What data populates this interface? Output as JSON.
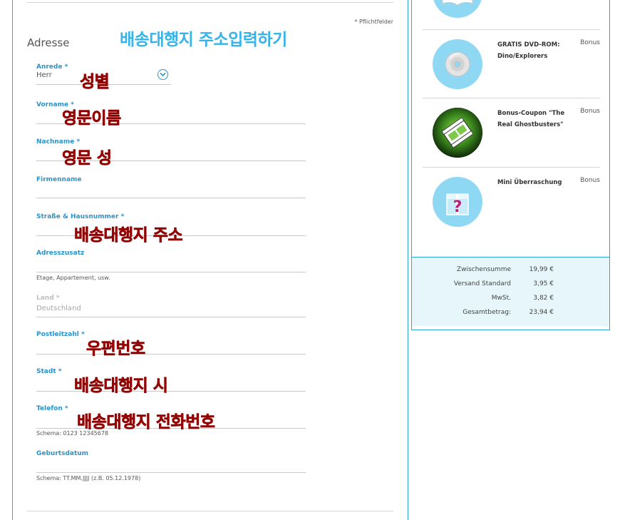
{
  "form": {
    "required_note": "* Pflichtfelder",
    "section_title": "Adresse",
    "fields": {
      "salutation": {
        "label": "Anrede *",
        "value": "Herr"
      },
      "first_name": {
        "label": "Vorname *"
      },
      "last_name": {
        "label": "Nachname *"
      },
      "company": {
        "label": "Firmenname"
      },
      "street": {
        "label": "Straße & Hausnummer *"
      },
      "address_extra": {
        "label": "Adresszusatz",
        "hint": "Etage, Appartement, usw."
      },
      "country": {
        "label": "Land *",
        "value": "Deutschland"
      },
      "zip": {
        "label": "Postleitzahl *"
      },
      "city": {
        "label": "Stadt *"
      },
      "phone": {
        "label": "Telefon *",
        "hint": "Schema: 0123 12345678"
      },
      "birthdate": {
        "label": "Geburtsdatum",
        "hint": "Schema: TT.MM.JJJJ (z.B. 05.12.1978)"
      }
    }
  },
  "annotations": {
    "title": "배송대행지 주소입력하기",
    "salutation": "성별",
    "first_name": "영문이름",
    "last_name": "영문 성",
    "street": "배송대행지 주소",
    "zip": "우편번호",
    "city": "배송대행지 시",
    "phone": "배송대행지 전화번호"
  },
  "cart": {
    "items": [
      {
        "name": "GRATIS DVD-ROM: Dino/Explorers",
        "badge": "Bonus",
        "icon": "dvd-icon"
      },
      {
        "name": "Bonus-Coupon \"The Real Ghostbusters\"",
        "badge": "Bonus",
        "icon": "film-icon"
      },
      {
        "name": "Mini Überraschung",
        "badge": "Bonus",
        "icon": "gift-question-icon"
      }
    ],
    "totals": [
      {
        "label": "Zwischensumme",
        "value": "19,99 €"
      },
      {
        "label": "Versand Standard",
        "value": "3,95 €"
      },
      {
        "label": "MwSt.",
        "value": "3,82 €"
      },
      {
        "label": "Gesamtbetrag:",
        "value": "23,94 €"
      }
    ]
  },
  "colors": {
    "accent": "#2b93c9",
    "border": "#2aa7d6",
    "annotation_red": "#d40000",
    "annotation_blue": "#36b3e8"
  }
}
